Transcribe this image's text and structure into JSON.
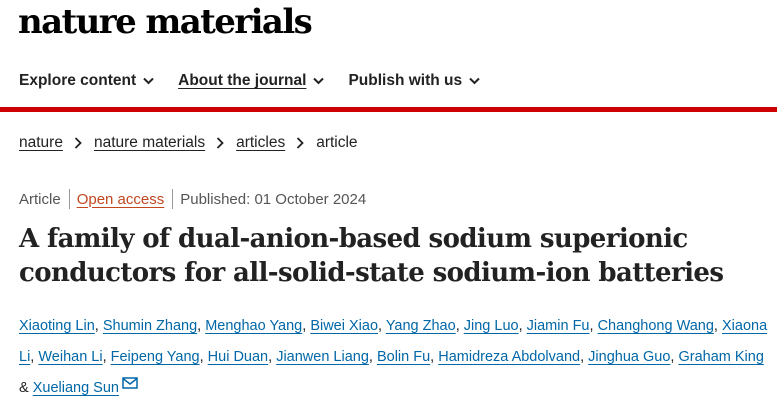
{
  "site": {
    "logo_text": "nature materials"
  },
  "nav": [
    {
      "label": "Explore content",
      "icon": "chevron-down-icon"
    },
    {
      "label": "About the journal",
      "icon": "chevron-down-icon"
    },
    {
      "label": "Publish with us",
      "icon": "chevron-down-icon"
    }
  ],
  "colors": {
    "accent_red": "#cc0000",
    "author_link": "#0067a8",
    "open_access": "#c2471f"
  },
  "breadcrumb": [
    {
      "label": "nature"
    },
    {
      "label": "nature materials"
    },
    {
      "label": "articles"
    },
    {
      "label": "article"
    }
  ],
  "article": {
    "type": "Article",
    "access": "Open access",
    "published": "Published: 01 October 2024",
    "title": "A family of dual-anion-based sodium superionic conductors for all-solid-state sodium-ion batteries",
    "authors": [
      "Xiaoting Lin",
      "Shumin Zhang",
      "Menghao Yang",
      "Biwei Xiao",
      "Yang Zhao",
      "Jing Luo",
      "Jiamin Fu",
      "Changhong Wang",
      "Xiaona Li",
      "Weihan Li",
      "Feipeng Yang",
      "Hui Duan",
      "Jianwen Liang",
      "Bolin Fu",
      "Hamidreza Abdolvand",
      "Jinghua Guo",
      "Graham King",
      "Xueliang Sun"
    ],
    "author_separator": ", ",
    "last_separator": " & "
  }
}
